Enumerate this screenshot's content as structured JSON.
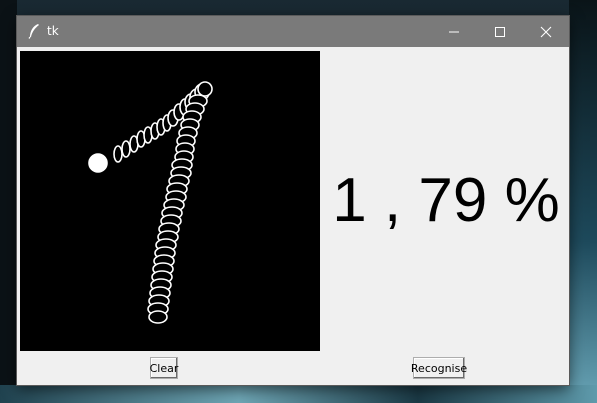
{
  "window": {
    "title": "tk",
    "app_icon": "feather-icon",
    "controls": [
      "minimize-icon",
      "maximize-icon",
      "close-icon"
    ]
  },
  "canvas": {
    "background": "#000000",
    "stroke_color": "#ffffff",
    "drawn_digit": "1"
  },
  "result": {
    "text": "1 , 79 %"
  },
  "buttons": {
    "clear": "Clear",
    "recognise": "Recognise"
  }
}
